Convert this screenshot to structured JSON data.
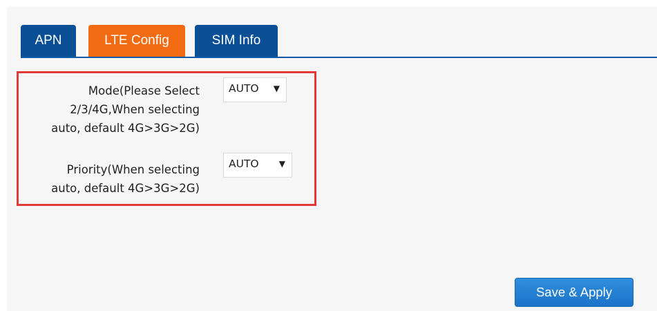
{
  "tabs": [
    {
      "label": "APN"
    },
    {
      "label": "LTE Config"
    },
    {
      "label": "SIM Info"
    }
  ],
  "active_tab": "LTE Config",
  "colors": {
    "tab_inactive": "#0b4f96",
    "tab_active": "#f06b12",
    "highlight_frame": "#e23a3a",
    "button": "#1c73c8"
  },
  "form": {
    "mode": {
      "label_lines": [
        "Mode(Please Select",
        "2/3/4G,When selecting",
        "auto, default 4G>3G>2G)"
      ],
      "selected": "AUTO",
      "arrow": "▼"
    },
    "priority": {
      "label_lines": [
        "Priority(When selecting",
        "auto, default 4G>3G>2G)"
      ],
      "selected": "AUTO",
      "arrow": "▼"
    }
  },
  "actions": {
    "save_label": "Save & Apply"
  }
}
